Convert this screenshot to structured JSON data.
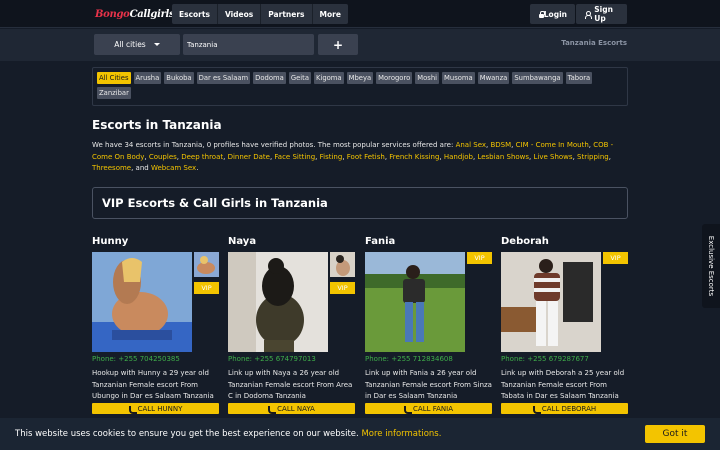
{
  "header": {
    "logo_text_1": "Bongo",
    "logo_text_2": "Callgirls",
    "nav": [
      "Escorts",
      "Videos",
      "Partners",
      "More"
    ],
    "login": "Login",
    "signup": "Sign Up"
  },
  "filter": {
    "city_select": "All cities",
    "search_value": "Tanzania",
    "plus": "+",
    "breadcrumb": "Tanzania Escorts"
  },
  "cities": [
    "All Cities",
    "Arusha",
    "Bukoba",
    "Dar es Salaam",
    "Dodoma",
    "Geita",
    "Kigoma",
    "Mbeya",
    "Morogoro",
    "Moshi",
    "Musoma",
    "Mwanza",
    "Sumbawanga",
    "Tabora",
    "Zanzibar"
  ],
  "page": {
    "title": "Escorts in Tanzania",
    "intro_start": "We have 34 escorts in Tanzania, 0 profiles have verified photos. The most popular services offered are: ",
    "services": [
      "Anal Sex",
      "BDSM",
      "CIM - Come In Mouth",
      "COB - Come On Body",
      "Couples",
      "Deep throat",
      "Dinner Date",
      "Face Sitting",
      "Fisting",
      "Foot Fetish",
      "French Kissing",
      "Handjob",
      "Lesbian Shows",
      "Live Shows",
      "Stripping",
      "Threesome"
    ],
    "intro_and": ", and ",
    "last_service": "Webcam Sex",
    "intro_end": ".",
    "vip_heading": "VIP Escorts & Call Girls in Tanzania"
  },
  "cards": [
    {
      "name": "Hunny",
      "phone": "Phone: +255 704250385",
      "desc": "Hookup with Hunny a 29 year old Tanzanian Female escort From Ubungo in Dar es Salaam Tanzania",
      "call": "CALL HUNNY",
      "vip": "VIP"
    },
    {
      "name": "Naya",
      "phone": "Phone: +255 674797013",
      "desc": "Link up with Naya a 26 year old Tanzanian Female escort From Area C in Dodoma Tanzania",
      "call": "CALL NAYA",
      "vip": "VIP"
    },
    {
      "name": "Fania",
      "phone": "Phone: +255 712834608",
      "desc": "Link up with Fania a 26 year old Tanzanian Female escort From Sinza in Dar es Salaam Tanzania",
      "call": "CALL FANIA",
      "vip": "VIP"
    },
    {
      "name": "Deborah",
      "phone": "Phone: +255 679287677",
      "desc": "Link up with Deborah a 25 year old Tanzanian Female escort From Tabata in Dar es Salaam Tanzania",
      "call": "CALL DEBORAH",
      "vip": "VIP"
    }
  ],
  "side_tab": "Exclusive Escorts",
  "cookie": {
    "message": "This website uses cookies to ensure you get the best experience on our website.",
    "link": "More informations.",
    "button": "Got it"
  }
}
